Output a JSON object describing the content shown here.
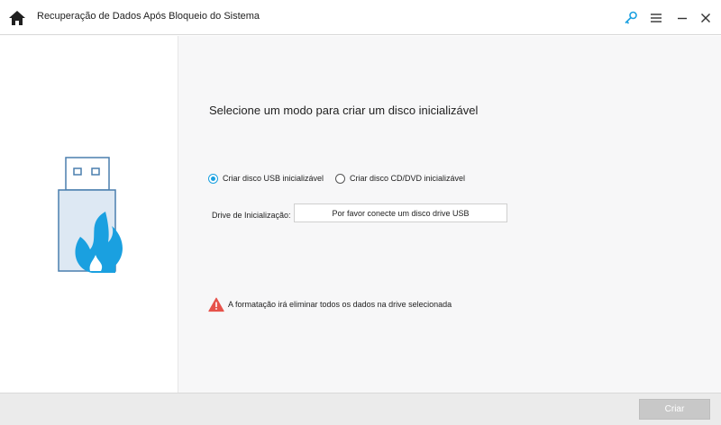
{
  "app": {
    "title": "Recuperação de Dados Após Bloqueio do Sistema"
  },
  "titlebar": {
    "icons": [
      "home-icon",
      "key-icon",
      "menu-icon",
      "minimize-icon",
      "close-icon"
    ]
  },
  "main": {
    "heading": "Selecione um modo para criar um disco inicializável",
    "modes": [
      {
        "label": "Criar disco USB inicializável",
        "selected": true
      },
      {
        "label": "Criar disco CD/DVD inicializável",
        "selected": false
      }
    ],
    "drive": {
      "label": "Drive de Inicialização:",
      "value": "Por favor conecte um disco drive USB"
    },
    "warning": {
      "icon": "warning-icon",
      "text": "A formatação irá eliminar todos os dados na drive selecionada"
    }
  },
  "footer": {
    "create_label": "Criar"
  },
  "colors": {
    "accent": "#1aa0e0",
    "illustration_outline": "#4a7fae",
    "illustration_fill": "#dde8f3",
    "warning": "#e6524b",
    "disabled_button": "#c8c8c8"
  }
}
